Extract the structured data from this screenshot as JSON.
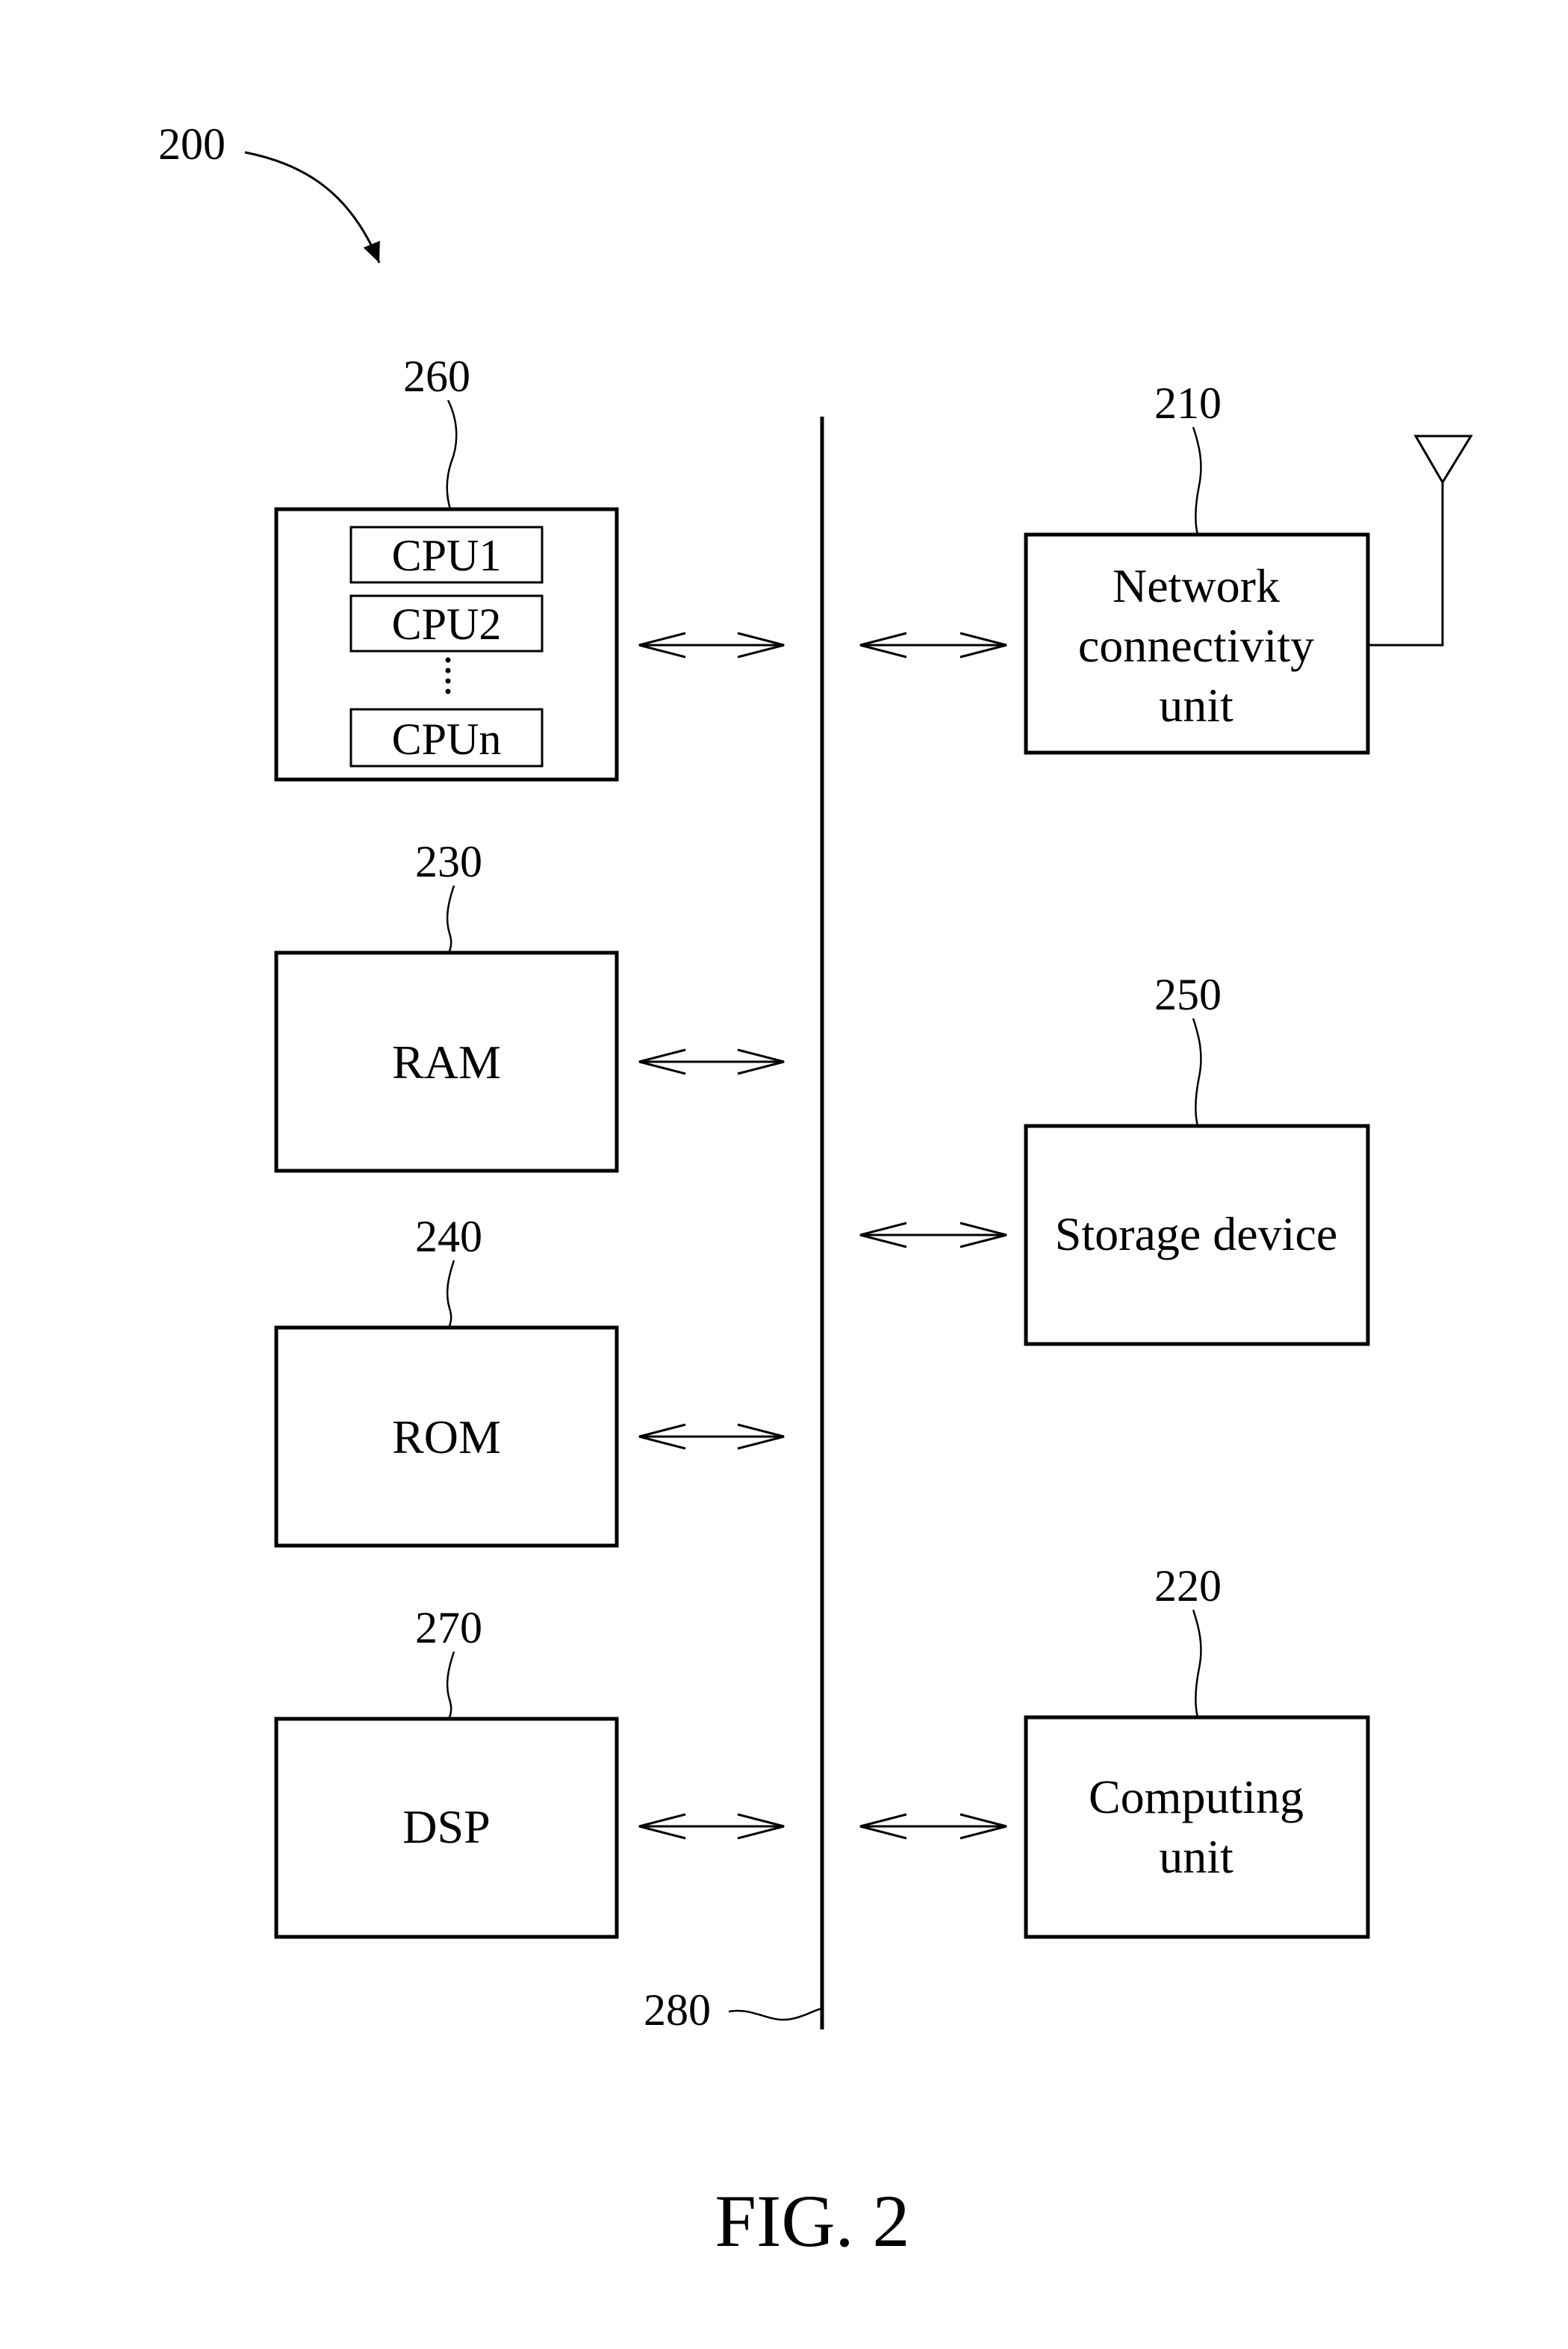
{
  "figure": {
    "caption": "FIG. 2",
    "system_ref": "200",
    "bus": {
      "ref": "280"
    },
    "left_blocks": [
      {
        "id": "processor",
        "ref": "260",
        "cpus": [
          "CPU1",
          "CPU2",
          "CPUn"
        ],
        "ellipsis": "⋮"
      },
      {
        "id": "ram",
        "ref": "230",
        "label": "RAM"
      },
      {
        "id": "rom",
        "ref": "240",
        "label": "ROM"
      },
      {
        "id": "dsp",
        "ref": "270",
        "label": "DSP"
      }
    ],
    "right_blocks": [
      {
        "id": "network",
        "ref": "210",
        "label_lines": [
          "Network",
          "connectivity",
          "unit"
        ],
        "icon": "antenna-icon"
      },
      {
        "id": "storage",
        "ref": "250",
        "label": "Storage device"
      },
      {
        "id": "computing",
        "ref": "220",
        "label_lines": [
          "Computing",
          "unit"
        ]
      }
    ],
    "connections": [
      {
        "from": "processor",
        "to": "bus",
        "type": "bidirectional"
      },
      {
        "from": "ram",
        "to": "bus",
        "type": "bidirectional"
      },
      {
        "from": "rom",
        "to": "bus",
        "type": "bidirectional"
      },
      {
        "from": "dsp",
        "to": "bus",
        "type": "bidirectional"
      },
      {
        "from": "bus",
        "to": "network",
        "type": "bidirectional"
      },
      {
        "from": "bus",
        "to": "storage",
        "type": "bidirectional"
      },
      {
        "from": "bus",
        "to": "computing",
        "type": "bidirectional"
      }
    ]
  }
}
